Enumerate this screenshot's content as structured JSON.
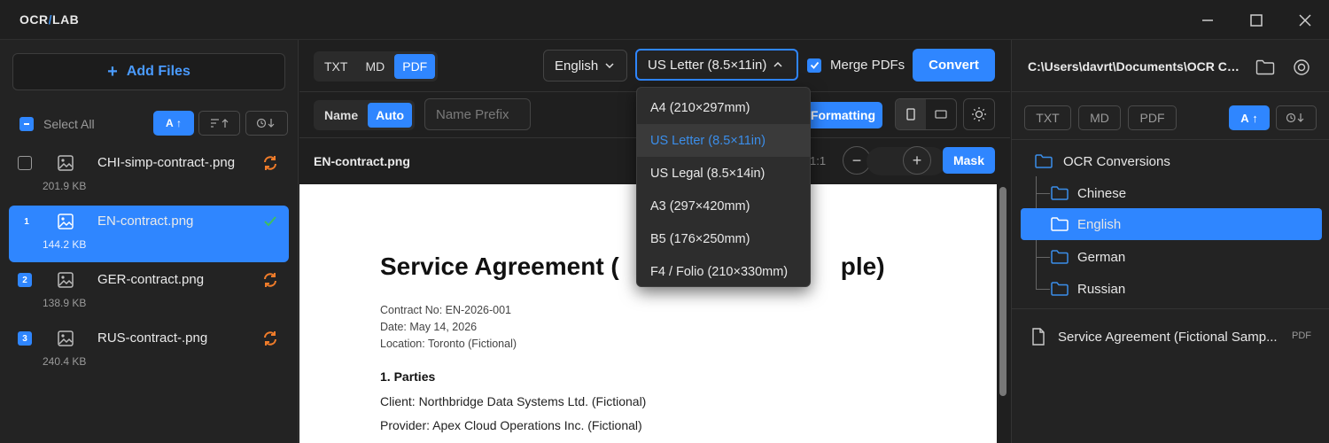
{
  "app": {
    "logo_left": "OCR",
    "logo_slash": "/",
    "logo_right": "LAB"
  },
  "left_panel": {
    "add_files_label": "Add Files",
    "select_all_label": "Select All",
    "sort_active_label": "A",
    "files": [
      {
        "num": "",
        "name": "CHI-simp-contract-.png",
        "size": "201.9 KB",
        "status": "pending"
      },
      {
        "num": "1",
        "name": "EN-contract.png",
        "size": "144.2 KB",
        "status": "done"
      },
      {
        "num": "2",
        "name": "GER-contract.png",
        "size": "138.9 KB",
        "status": "pending"
      },
      {
        "num": "3",
        "name": "RUS-contract-.png",
        "size": "240.4 KB",
        "status": "pending"
      }
    ]
  },
  "toolbar": {
    "formats": [
      "TXT",
      "MD",
      "PDF"
    ],
    "active_format": "PDF",
    "language": "English",
    "page_size": "US Letter (8.5×11in)",
    "merge_label": "Merge PDFs",
    "merge_checked": true,
    "convert_label": "Convert"
  },
  "subtoolbar": {
    "name_label": "Name",
    "auto_label": "Auto",
    "prefix_placeholder": "Name Prefix",
    "formatting_label": "Formatting"
  },
  "preview": {
    "file_name": "EN-contract.png",
    "zoom_label": "1:1",
    "mask_label": "Mask",
    "doc": {
      "title": "Service Agreement (",
      "title_end": "ple)",
      "contract_no": "Contract No: EN-2026-001",
      "date": "Date: May 14, 2026",
      "location": "Location: Toronto (Fictional)",
      "section": "1. Parties",
      "client": "Client: Northbridge Data Systems Ltd. (Fictional)",
      "provider": "Provider: Apex Cloud Operations Inc. (Fictional)"
    }
  },
  "page_size_menu": {
    "options": [
      "A4 (210×297mm)",
      "US Letter (8.5×11in)",
      "US Legal (8.5×14in)",
      "A3 (297×420mm)",
      "B5 (176×250mm)",
      "F4 / Folio (210×330mm)"
    ],
    "selected": "US Letter (8.5×11in)"
  },
  "right_panel": {
    "path": "C:\\Users\\davrt\\Documents\\OCR Conversions",
    "filters": [
      "TXT",
      "MD",
      "PDF"
    ],
    "sort_label": "A",
    "tree": [
      {
        "label": "OCR Conversions",
        "level": 0
      },
      {
        "label": "Chinese",
        "level": 1
      },
      {
        "label": "English",
        "level": 1,
        "selected": true
      },
      {
        "label": "German",
        "level": 1
      },
      {
        "label": "Russian",
        "level": 1
      }
    ],
    "output_file": "Service Agreement (Fictional Samp...",
    "output_type": "PDF"
  },
  "colors": {
    "accent": "#2f86ff",
    "warning": "#f07c2a",
    "success": "#3fbf5f",
    "background": "#1f1f1f"
  }
}
